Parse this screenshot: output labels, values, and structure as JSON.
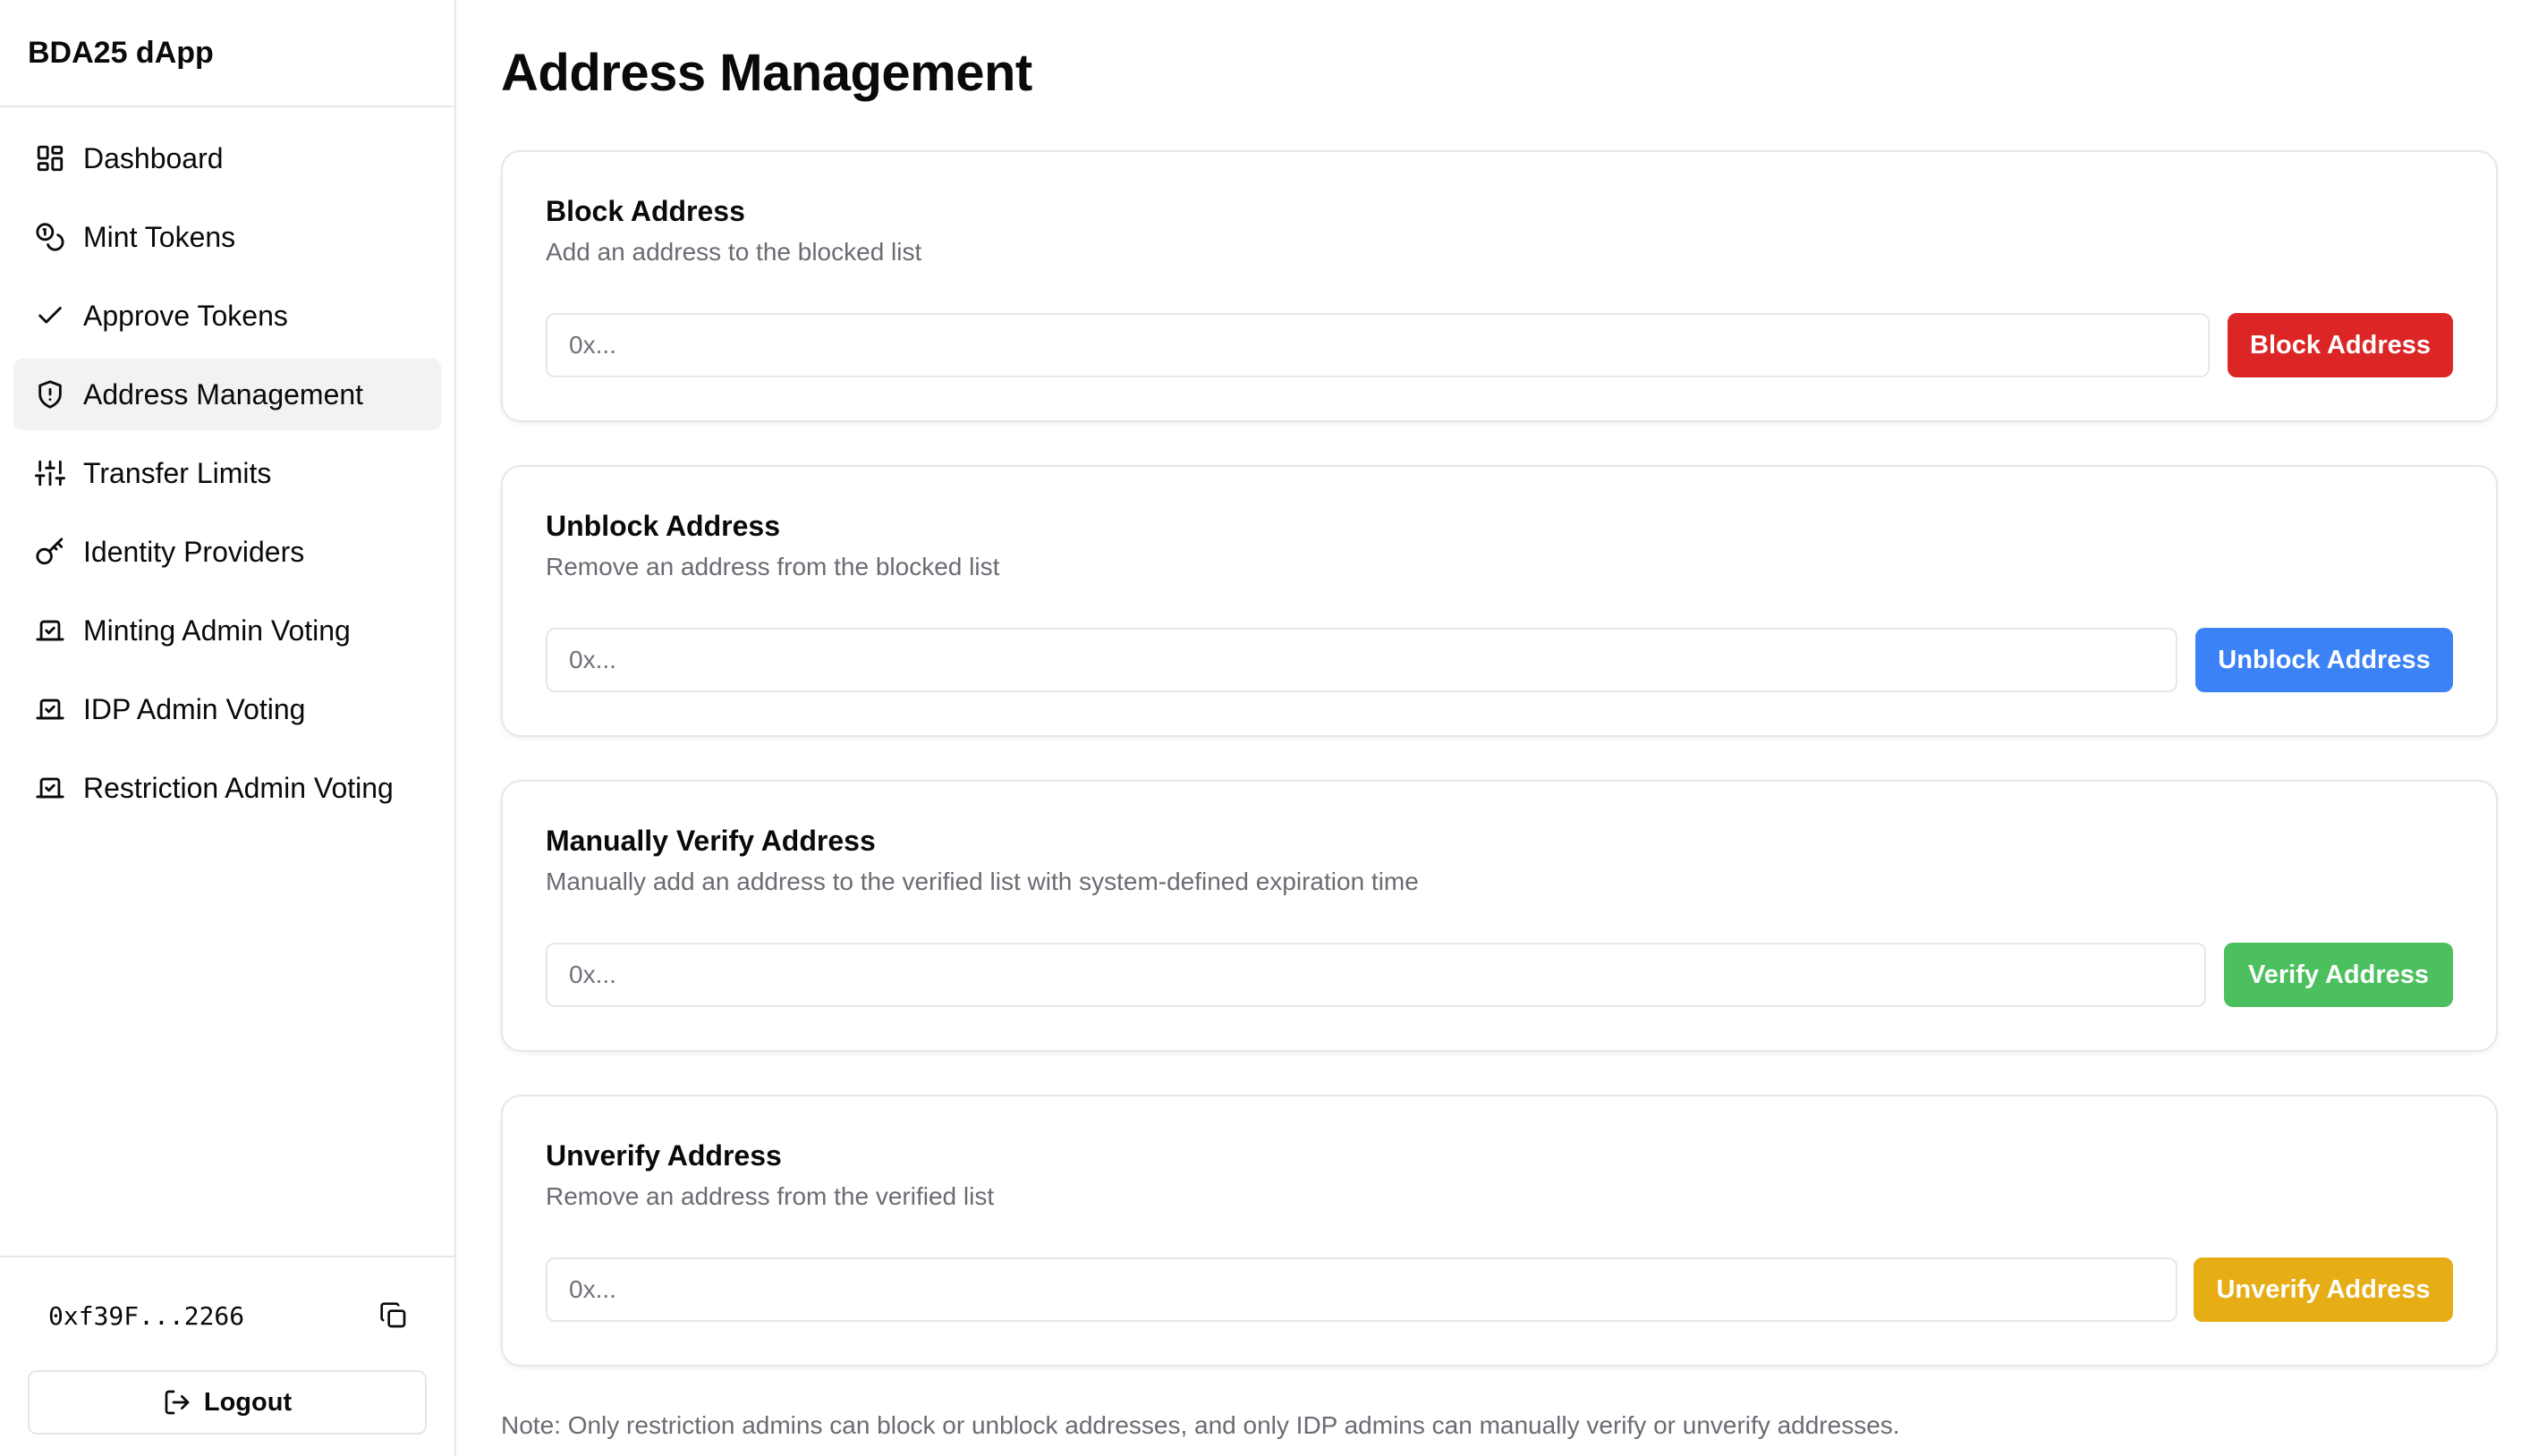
{
  "app": {
    "title": "BDA25 dApp"
  },
  "sidebar": {
    "items": [
      {
        "label": "Dashboard",
        "icon": "dashboard-icon",
        "active": false
      },
      {
        "label": "Mint Tokens",
        "icon": "coins-icon",
        "active": false
      },
      {
        "label": "Approve Tokens",
        "icon": "check-icon",
        "active": false
      },
      {
        "label": "Address Management",
        "icon": "shield-icon",
        "active": true
      },
      {
        "label": "Transfer Limits",
        "icon": "sliders-icon",
        "active": false
      },
      {
        "label": "Identity Providers",
        "icon": "key-icon",
        "active": false
      },
      {
        "label": "Minting Admin Voting",
        "icon": "vote-icon",
        "active": false
      },
      {
        "label": "IDP Admin Voting",
        "icon": "vote-icon",
        "active": false
      },
      {
        "label": "Restriction Admin Voting",
        "icon": "vote-icon",
        "active": false
      }
    ],
    "wallet_address": "0xf39F...2266",
    "logout_label": "Logout"
  },
  "main": {
    "title": "Address Management",
    "cards": [
      {
        "title": "Block Address",
        "description": "Add an address to the blocked list",
        "placeholder": "0x...",
        "button_label": "Block Address",
        "button_color": "#dc2626"
      },
      {
        "title": "Unblock Address",
        "description": "Remove an address from the blocked list",
        "placeholder": "0x...",
        "button_label": "Unblock Address",
        "button_color": "#3b82f6"
      },
      {
        "title": "Manually Verify Address",
        "description": "Manually add an address to the verified list with system-defined expiration time",
        "placeholder": "0x...",
        "button_label": "Verify Address",
        "button_color": "#4cbf5e"
      },
      {
        "title": "Unverify Address",
        "description": "Remove an address from the verified list",
        "placeholder": "0x...",
        "button_label": "Unverify Address",
        "button_color": "#e6ad14"
      }
    ],
    "note": "Note: Only restriction admins can block or unblock addresses, and only IDP admins can manually verify or unverify addresses."
  }
}
